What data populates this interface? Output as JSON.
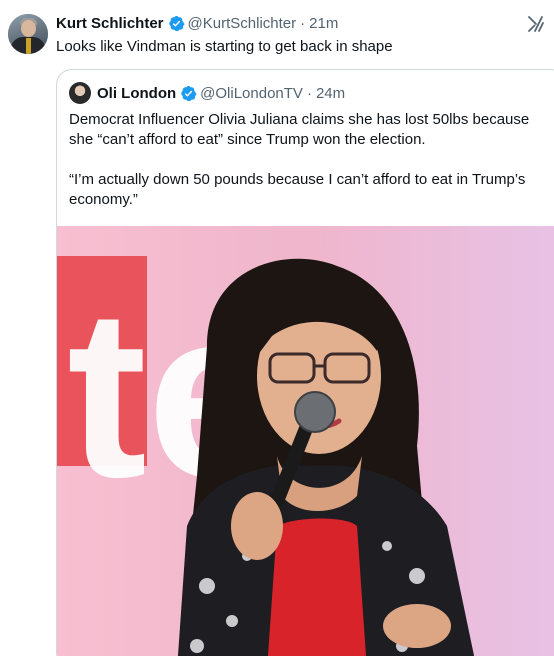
{
  "tweet": {
    "author_name": "Kurt Schlichter",
    "author_handle": "@KurtSchlichter",
    "separator": "·",
    "time": "21m",
    "text": "Looks like Vindman is starting to get back in shape"
  },
  "quoted": {
    "author_name": "Oli London",
    "author_handle": "@OliLondonTV",
    "separator": "·",
    "time": "24m",
    "paragraph_1": "Democrat Influencer Olivia Juliana claims she has lost 50lbs because she “can’t afford to eat” since Trump won the election.",
    "paragraph_2": "“I’m actually down 50 pounds because I can’t afford to eat in Trump’s economy.”",
    "photo_backdrop_text": "tee"
  },
  "colors": {
    "verified_blue": "#1d9bf0",
    "secondary_text": "#536471",
    "backdrop_pink": "#f4c3d3",
    "backdrop_red": "#e8474f",
    "shirt_red": "#d8232a"
  },
  "icons": {
    "verified": "verified-badge-icon",
    "grok": "grok-icon"
  }
}
